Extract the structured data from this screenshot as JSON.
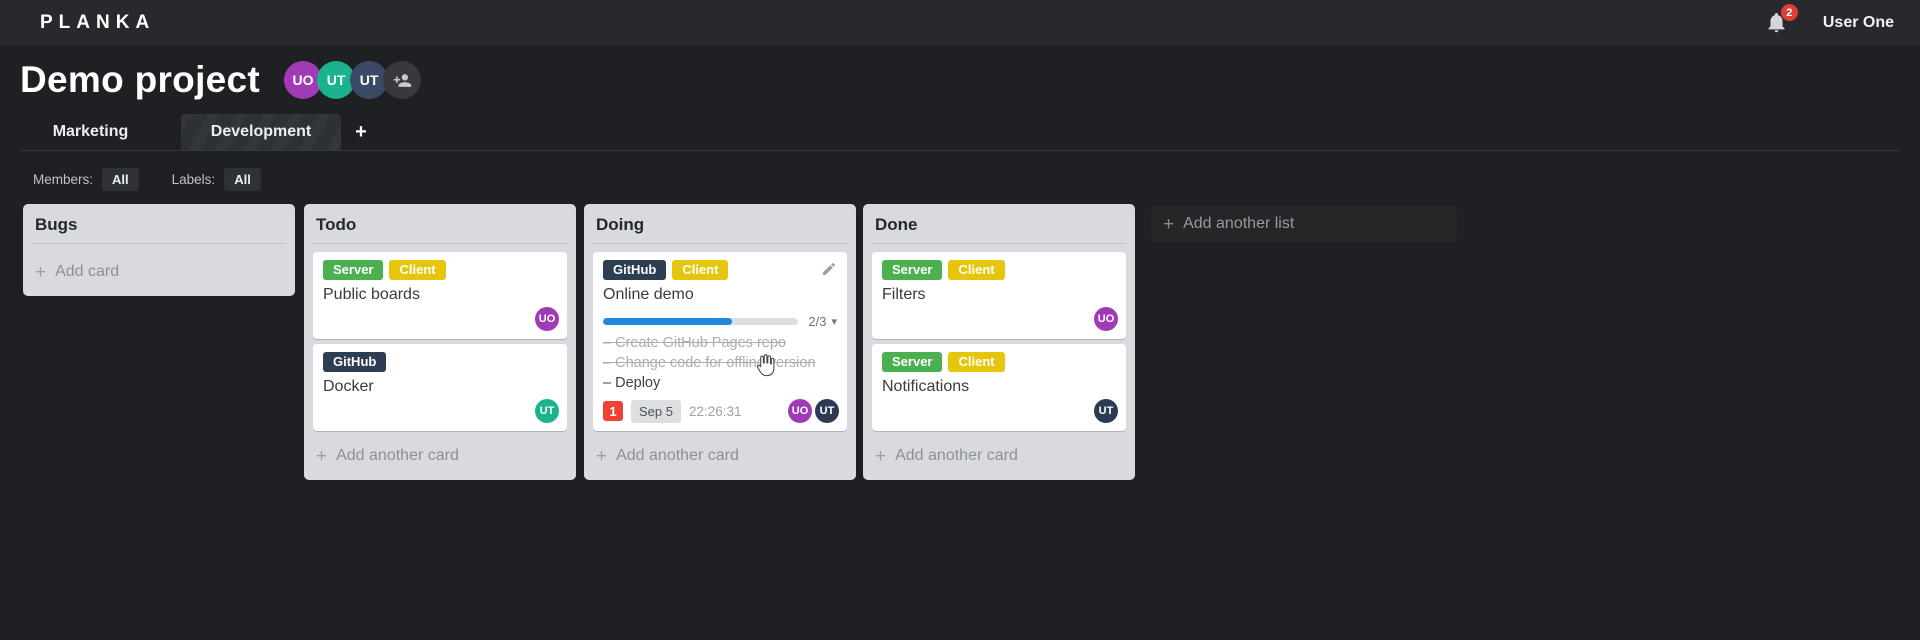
{
  "icons": {
    "plus": "+",
    "caret_down": "▾"
  },
  "topbar": {
    "logo": "PLANKA",
    "notification_count": "2",
    "user_name": "User One"
  },
  "project": {
    "title": "Demo project",
    "members": [
      {
        "initials": "UO",
        "color": "#a03bb5"
      },
      {
        "initials": "UT",
        "color": "#1bb28e"
      },
      {
        "initials": "UT",
        "color": "#3a4a66"
      }
    ]
  },
  "tabs": {
    "items": [
      {
        "label": "Marketing",
        "active": false
      },
      {
        "label": "Development",
        "active": true
      }
    ]
  },
  "filters": {
    "members_label": "Members:",
    "members_value": "All",
    "labels_label": "Labels:",
    "labels_value": "All"
  },
  "board": {
    "task_marker": "–",
    "add_list_label": "Add another list",
    "lists": [
      {
        "name": "Bugs",
        "add_label": "Add card",
        "cards": []
      },
      {
        "name": "Todo",
        "add_label": "Add another card",
        "cards": [
          {
            "title": "Public boards",
            "labels": [
              {
                "text": "Server",
                "color": "#4caf50"
              },
              {
                "text": "Client",
                "color": "#e6c60d"
              }
            ],
            "members": [
              {
                "initials": "UO",
                "color": "#a03bb5"
              }
            ]
          },
          {
            "title": "Docker",
            "labels": [
              {
                "text": "GitHub",
                "color": "#2d3e53"
              }
            ],
            "members": [
              {
                "initials": "UT",
                "color": "#1bb28e"
              }
            ]
          }
        ]
      },
      {
        "name": "Doing",
        "add_label": "Add another card",
        "cards": [
          {
            "title": "Online demo",
            "labels": [
              {
                "text": "GitHub",
                "color": "#2d3e53"
              },
              {
                "text": "Client",
                "color": "#e6c60d"
              }
            ],
            "editable": true,
            "progress": {
              "percent": 66,
              "label": "2/3"
            },
            "tasks": [
              {
                "text": "Create GitHub Pages repo",
                "done": true
              },
              {
                "text": "Change code for offline version",
                "done": true
              },
              {
                "text": "Deploy",
                "done": false
              }
            ],
            "badges": {
              "notification_count": "1",
              "due_date": "Sep 5",
              "timer": "22:26:31"
            },
            "members": [
              {
                "initials": "UO",
                "color": "#a03bb5"
              },
              {
                "initials": "UT",
                "color": "#2c3b52"
              }
            ]
          }
        ]
      },
      {
        "name": "Done",
        "add_label": "Add another card",
        "cards": [
          {
            "title": "Filters",
            "labels": [
              {
                "text": "Server",
                "color": "#4caf50"
              },
              {
                "text": "Client",
                "color": "#e6c60d"
              }
            ],
            "members": [
              {
                "initials": "UO",
                "color": "#a03bb5"
              }
            ]
          },
          {
            "title": "Notifications",
            "labels": [
              {
                "text": "Server",
                "color": "#4caf50"
              },
              {
                "text": "Client",
                "color": "#e6c60d"
              }
            ],
            "members": [
              {
                "initials": "UT",
                "color": "#2c3b52"
              }
            ]
          }
        ]
      }
    ]
  }
}
